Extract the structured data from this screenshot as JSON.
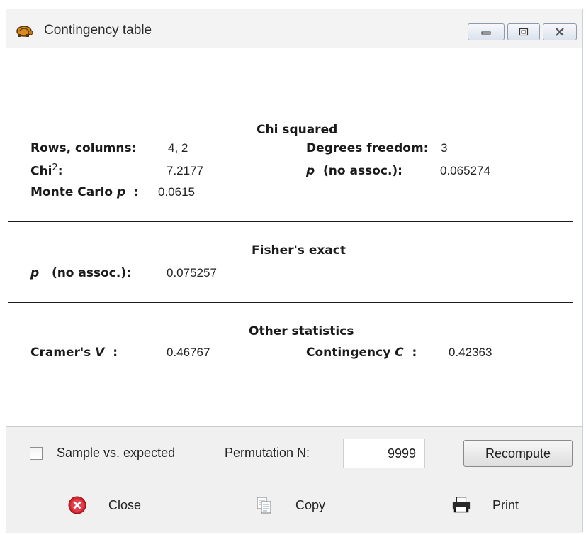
{
  "window": {
    "title": "Contingency table",
    "icon": "turtle-app-icon",
    "controls": [
      "minimize-icon",
      "restore-icon",
      "close-icon"
    ]
  },
  "chi_squared": {
    "heading": "Chi squared",
    "rows_columns_label": "Rows, columns:",
    "rows_columns_value": "4, 2",
    "degrees_freedom_label": "Degrees freedom:",
    "degrees_freedom_value": "3",
    "chi2_label": "Chi",
    "chi2_sup": "2",
    "chi2_colon": ":",
    "chi2_value": "7.2177",
    "p_label": "p",
    "p_suffix": "(no assoc.):",
    "p_value": "0.065274",
    "monte_carlo_label": "Monte Carlo",
    "monte_carlo_p": "p",
    "monte_carlo_colon": ":",
    "monte_carlo_value": "0.0615"
  },
  "fisher": {
    "heading": "Fisher's exact",
    "p_label": "p",
    "p_suffix": "(no assoc.):",
    "p_value": "0.075257"
  },
  "other": {
    "heading": "Other statistics",
    "cramers_label": "Cramer's",
    "cramers_v": "V",
    "cramers_colon": ":",
    "cramers_value": "0.46767",
    "contingency_label": "Contingency",
    "contingency_c": "C",
    "contingency_colon": ":",
    "contingency_value": "0.42363"
  },
  "options": {
    "sample_vs_expected_label": "Sample vs. expected",
    "sample_vs_expected_checked": false,
    "permutation_label": "Permutation N:",
    "permutation_value": "9999",
    "recompute_label": "Recompute"
  },
  "actions": {
    "close_label": "Close",
    "copy_label": "Copy",
    "print_label": "Print"
  },
  "colors": {
    "window_bg": "#ffffff",
    "bar_bg": "#f0f0f0",
    "rule": "#1e1e1e"
  }
}
